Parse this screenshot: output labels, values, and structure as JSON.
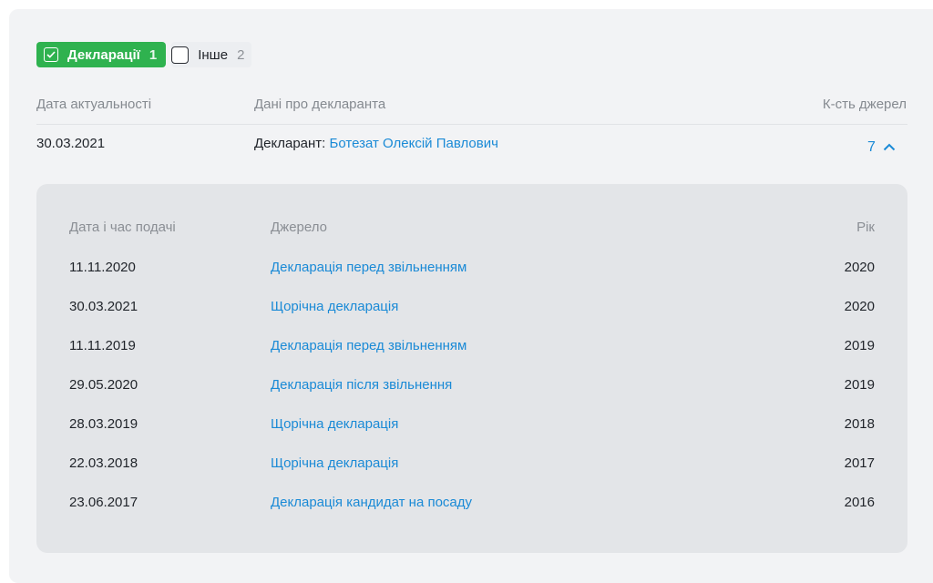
{
  "filters": [
    {
      "label": "Декларації",
      "count": "1",
      "checked": true
    },
    {
      "label": "Інше",
      "count": "2",
      "checked": false
    }
  ],
  "table": {
    "headers": {
      "date": "Дата актуальності",
      "declarant": "Дані про декларанта",
      "sources": "К-сть джерел"
    },
    "row": {
      "date": "30.03.2021",
      "declarant_prefix": "Декларант:",
      "declarant_name": "Ботезат Олексій Павлович",
      "sources_count": "7"
    }
  },
  "sources_table": {
    "headers": {
      "datetime": "Дата і час подачі",
      "source": "Джерело",
      "year": "Рік"
    },
    "rows": [
      {
        "date": "11.11.2020",
        "source": "Декларація перед звільненням",
        "year": "2020"
      },
      {
        "date": "30.03.2021",
        "source": "Щорічна декларація",
        "year": "2020"
      },
      {
        "date": "11.11.2019",
        "source": "Декларація перед звільненням",
        "year": "2019"
      },
      {
        "date": "29.05.2020",
        "source": "Декларація після звільнення",
        "year": "2019"
      },
      {
        "date": "28.03.2019",
        "source": "Щорічна декларація",
        "year": "2018"
      },
      {
        "date": "22.03.2018",
        "source": "Щорічна декларація",
        "year": "2017"
      },
      {
        "date": "23.06.2017",
        "source": "Декларація кандидат на посаду",
        "year": "2016"
      }
    ]
  },
  "icons": {
    "check": "check-icon",
    "collapse": "chevron-up-icon"
  },
  "colors": {
    "accent_green": "#2fb24f",
    "link_blue": "#1a8ad6"
  }
}
